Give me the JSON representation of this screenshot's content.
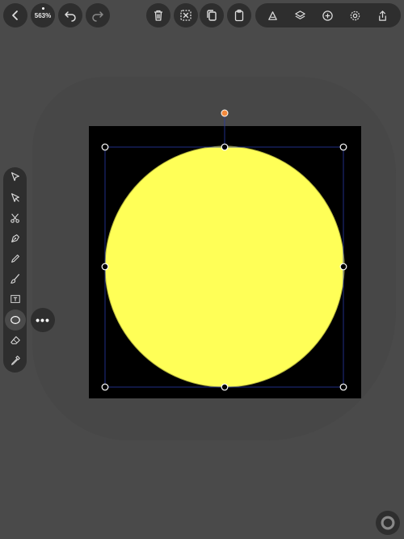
{
  "toolbar": {
    "zoom_label": "563%",
    "left_buttons": [
      "back",
      "zoom",
      "undo",
      "redo"
    ],
    "center_buttons": [
      "delete",
      "deselect",
      "duplicate",
      "paste"
    ],
    "right_buttons": [
      "style",
      "layers",
      "add",
      "settings",
      "share"
    ]
  },
  "tools": [
    "select",
    "direct-select",
    "scissors",
    "pen",
    "pencil",
    "brush",
    "text",
    "shape",
    "eraser",
    "eyedropper"
  ],
  "active_tool": "shape",
  "more_button": "•••",
  "canvas": {
    "artboard_color": "#000000",
    "shape_fill": "#ffff57",
    "selection_color": "#2a3aa8",
    "rotate_handle_color": "#f2883c"
  },
  "colors": {
    "background": "#4a4a4a",
    "panel": "#2e2e2e",
    "icon": "#dddddd"
  }
}
